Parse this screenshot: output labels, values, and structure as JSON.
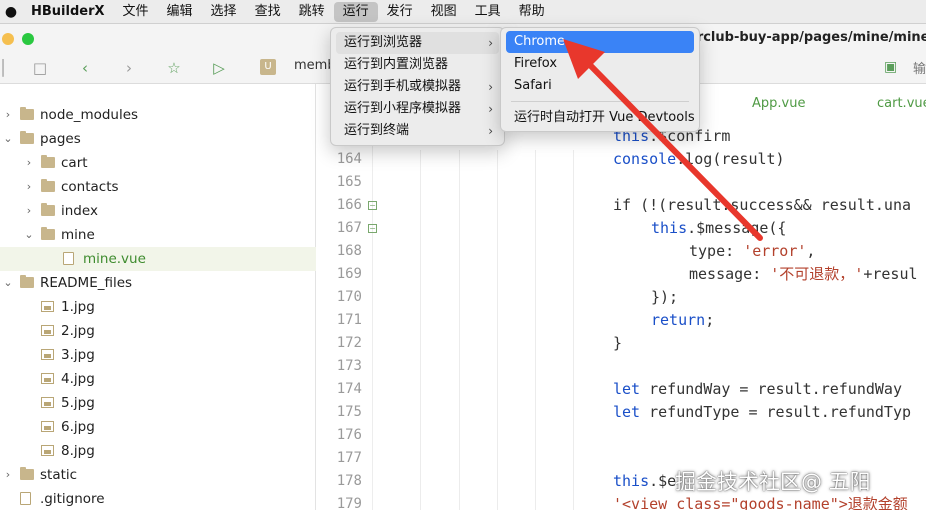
{
  "menubar": {
    "apple": "",
    "items": [
      "HBuilderX",
      "文件",
      "编辑",
      "选择",
      "查找",
      "跳转",
      "运行",
      "发行",
      "视图",
      "工具",
      "帮助"
    ]
  },
  "title_path": "erclub-buy-app/pages/mine/mine.vu",
  "toolbar": {
    "breadcrumb_icon": "U",
    "breadcrumb": "memb",
    "right_text": "输"
  },
  "tabs": {
    "app": "App.vue",
    "cart": "cart.vue"
  },
  "tree": [
    {
      "label": "node_modules"
    },
    {
      "label": "pages"
    },
    {
      "label": "cart"
    },
    {
      "label": "contacts"
    },
    {
      "label": "index"
    },
    {
      "label": "mine"
    },
    {
      "label": "mine.vue"
    },
    {
      "label": "README_files"
    },
    {
      "label": "1.jpg"
    },
    {
      "label": "2.jpg"
    },
    {
      "label": "3.jpg"
    },
    {
      "label": "4.jpg"
    },
    {
      "label": "5.jpg"
    },
    {
      "label": "6.jpg"
    },
    {
      "label": "8.jpg"
    },
    {
      "label": "static"
    },
    {
      "label": ".gitignore"
    }
  ],
  "line_numbers": [
    "164",
    "165",
    "166",
    "167",
    "168",
    "169",
    "170",
    "171",
    "172",
    "173",
    "174",
    "175",
    "176",
    "177",
    "178",
    "179"
  ],
  "run_menu": {
    "items": [
      "运行到浏览器",
      "运行到内置浏览器",
      "运行到手机或模拟器",
      "运行到小程序模拟器",
      "运行到终端"
    ]
  },
  "browser_menu": {
    "items": [
      "Chrome",
      "Firefox",
      "Safari"
    ],
    "devtools": "运行时自动打开 Vue Devtools"
  },
  "watermark": "掘金技术社区@ 五阳",
  "colors": {
    "accent": "#3a83f6",
    "arrow": "#e8372c",
    "keyword": "#1a4fc8",
    "string": "#b3412c"
  }
}
